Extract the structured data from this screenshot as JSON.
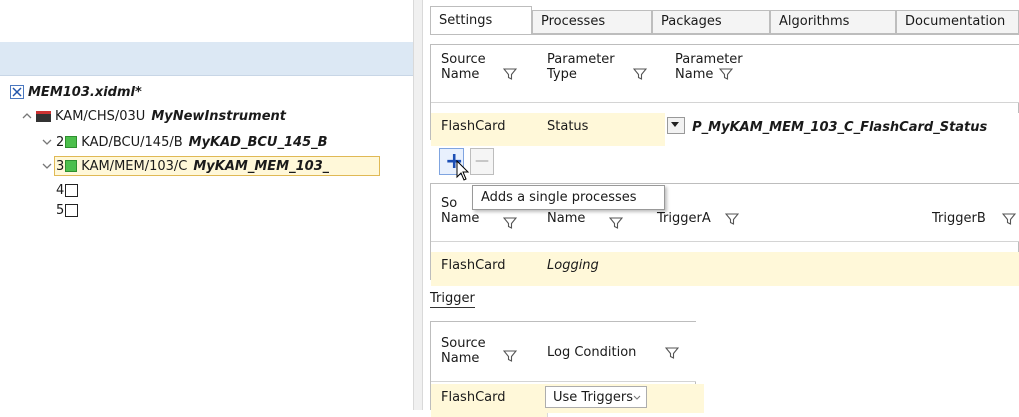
{
  "tree": {
    "root_label": "MEM103.xidml*",
    "chassis_path": "KAM/CHS/03U",
    "chassis_name": "MyNewInstrument",
    "slots": [
      {
        "num": "2",
        "path": "KAD/BCU/145/B",
        "name": "MyKAD_BCU_145_B"
      },
      {
        "num": "3",
        "path": "KAM/MEM/103/C",
        "name": "MyKAM_MEM_103_"
      },
      {
        "num": "4"
      },
      {
        "num": "5"
      }
    ]
  },
  "tabs": [
    "Settings",
    "Processes",
    "Packages",
    "Algorithms",
    "Documentation"
  ],
  "settings_grid": {
    "headers": [
      [
        "Source",
        "Name"
      ],
      [
        "Parameter",
        "Type"
      ],
      [
        "Parameter",
        "Name"
      ]
    ],
    "row": {
      "source": "FlashCard",
      "type": "Status",
      "param": "P_MyKAM_MEM_103_C_FlashCard_Status"
    }
  },
  "buttons": {
    "add": "+",
    "remove": "—"
  },
  "tooltip": "Adds a single processes",
  "process_grid": {
    "headers": [
      [
        "So",
        "Name"
      ],
      [
        "",
        "Name"
      ],
      [
        "TriggerA"
      ],
      [
        "TriggerB"
      ]
    ],
    "row": {
      "source": "FlashCard",
      "name": "Logging"
    }
  },
  "trigger_label": "Trigger",
  "trigger_grid": {
    "headers": [
      [
        "Source",
        "Name"
      ],
      [
        "Log Condition"
      ]
    ],
    "row": {
      "source": "FlashCard",
      "condition": "Use Triggers"
    }
  },
  "colors": {
    "selected_fill": "#fff8d9",
    "selected_border": "#e0b955",
    "slot_green": "#4cbf4c",
    "add_button": "#3b6fd0"
  }
}
